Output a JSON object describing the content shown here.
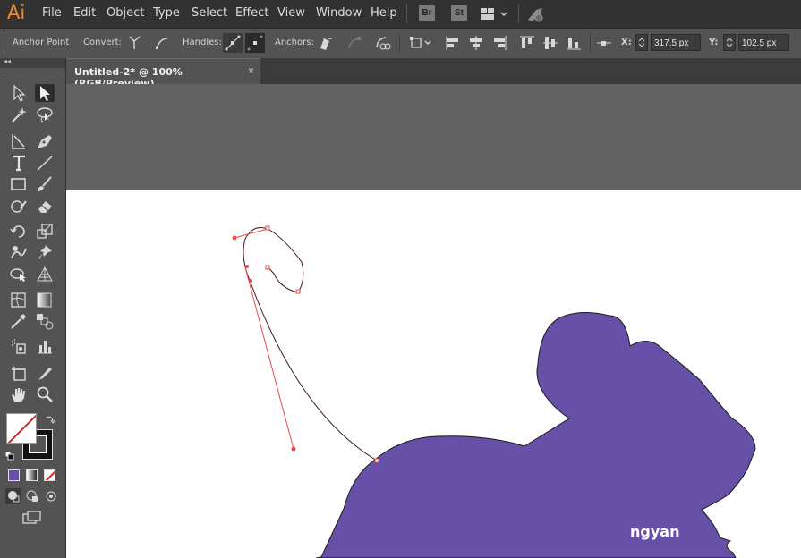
{
  "app": {
    "logo": "Ai"
  },
  "menu": [
    "File",
    "Edit",
    "Object",
    "Type",
    "Select",
    "Effect",
    "View",
    "Window",
    "Help"
  ],
  "bridge_buttons": [
    "Br",
    "St"
  ],
  "control_bar": {
    "anchor_point_label": "Anchor Point",
    "convert_label": "Convert:",
    "handles_label": "Handles:",
    "anchors_label": "Anchors:",
    "x_label": "X:",
    "x_value": "317.5 px",
    "y_label": "Y:",
    "y_value": "102.5 px"
  },
  "document_tab": {
    "title": "Untitled-2* @ 100% (RGB/Preview)",
    "close": "×"
  },
  "panel_collapse": "◂◂",
  "colors": {
    "accent": "#6650a8",
    "anchor": "#e84a4a",
    "logo": "#f28a2d"
  },
  "watermark": "ngyan"
}
